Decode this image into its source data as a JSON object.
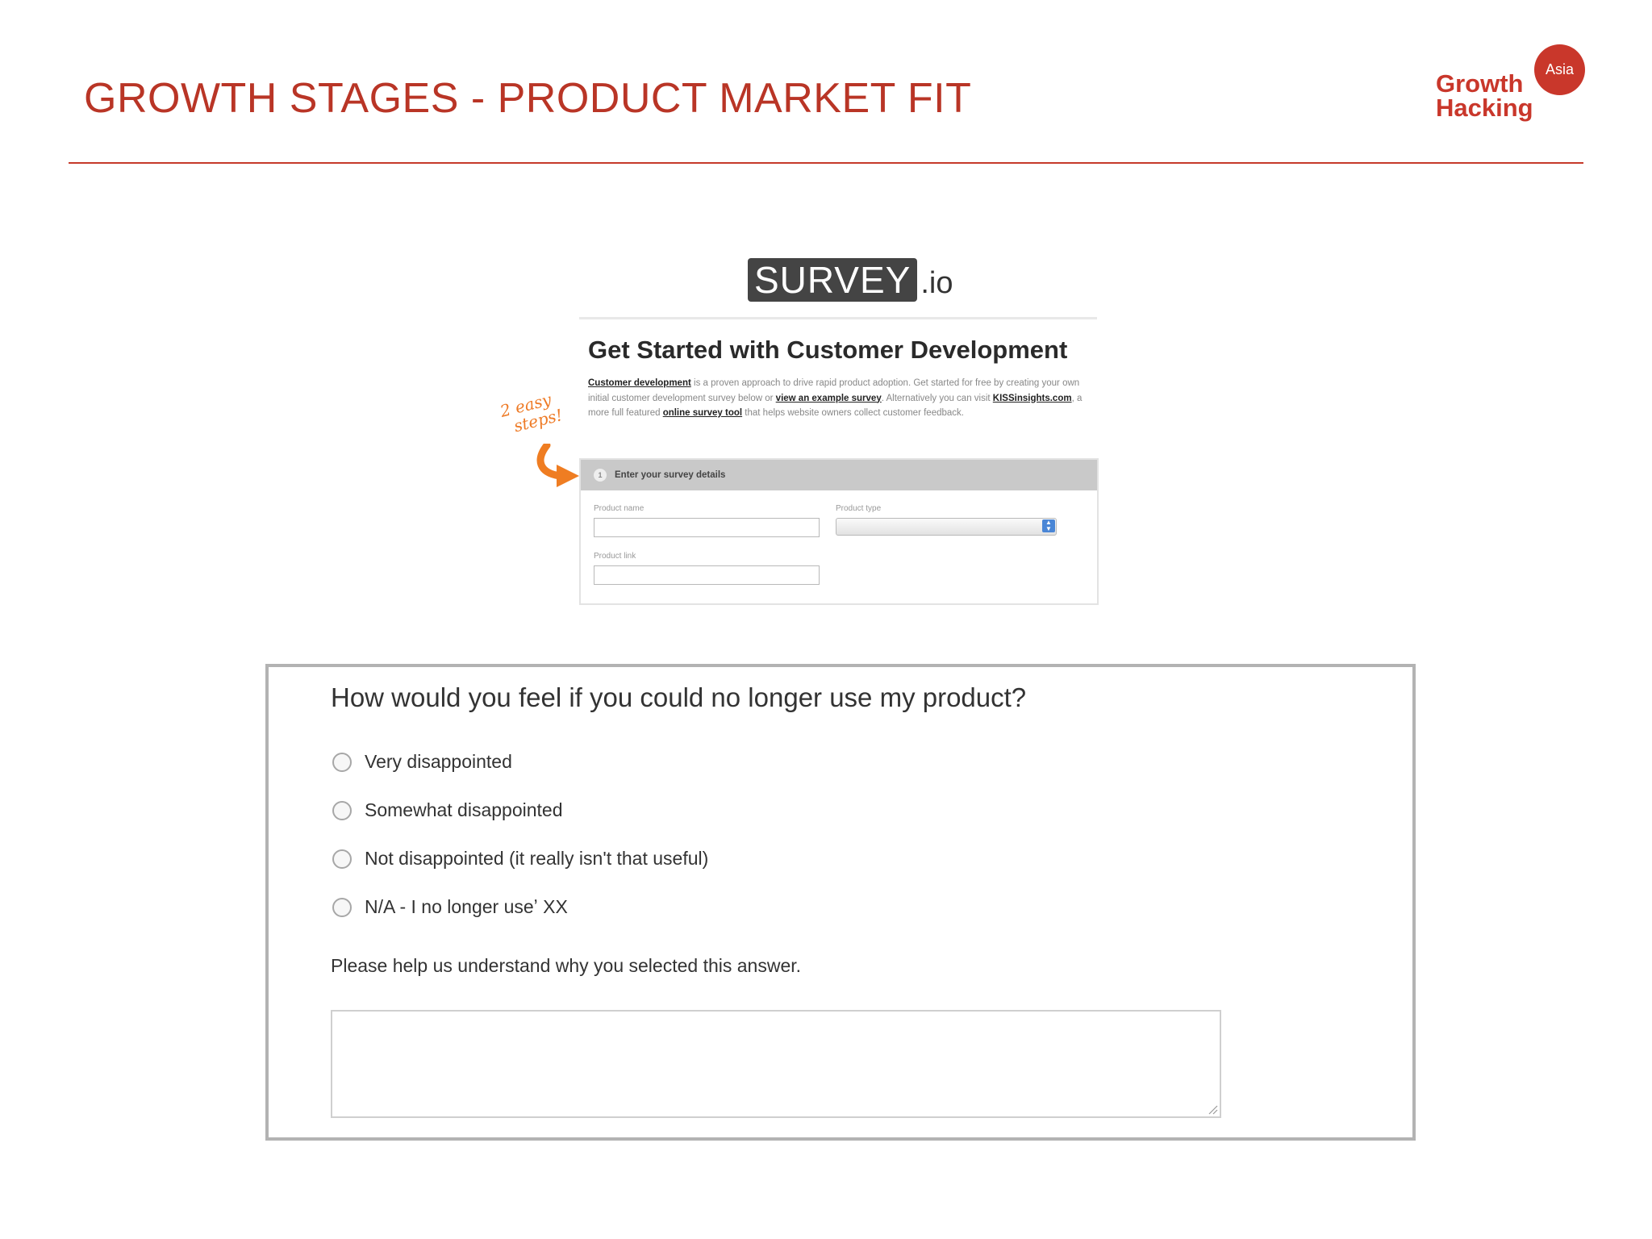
{
  "slide": {
    "title": "GROWTH STAGES - PRODUCT MARKET FIT",
    "logo": {
      "badge": "Asia",
      "line1": "Growth",
      "line2": "Hacking",
      "color": "#c9372b"
    },
    "accent_color": "#b93526"
  },
  "survey_io": {
    "logo_word": "SURVEY",
    "logo_suffix": ".io",
    "heading": "Get Started with Customer Development",
    "intro": {
      "link_customer_dev": "Customer development",
      "text1": " is a proven approach to drive rapid product adoption. Get started for free by creating your own initial customer development survey below or ",
      "link_example": "view an example survey",
      "text2": ". Alternatively you can visit ",
      "link_kiss": "KISSinsights.com",
      "text3": ", a more full featured ",
      "link_tool": "online survey tool",
      "text4": " that helps website owners collect customer feedback."
    },
    "steps_note_line1": "2 easy",
    "steps_note_line2": "steps!",
    "step_number": "1",
    "step_title": "Enter your survey details",
    "fields": {
      "product_name_label": "Product name",
      "product_type_label": "Product type",
      "product_link_label": "Product link"
    }
  },
  "question": {
    "title": "How would you feel if you could no longer use my product?",
    "options": [
      "Very disappointed",
      "Somewhat disappointed",
      "Not disappointed (it really isn't that useful)",
      "N/A - I no longer useʼ   XX"
    ],
    "help_text": "Please help us understand why you selected this answer."
  }
}
